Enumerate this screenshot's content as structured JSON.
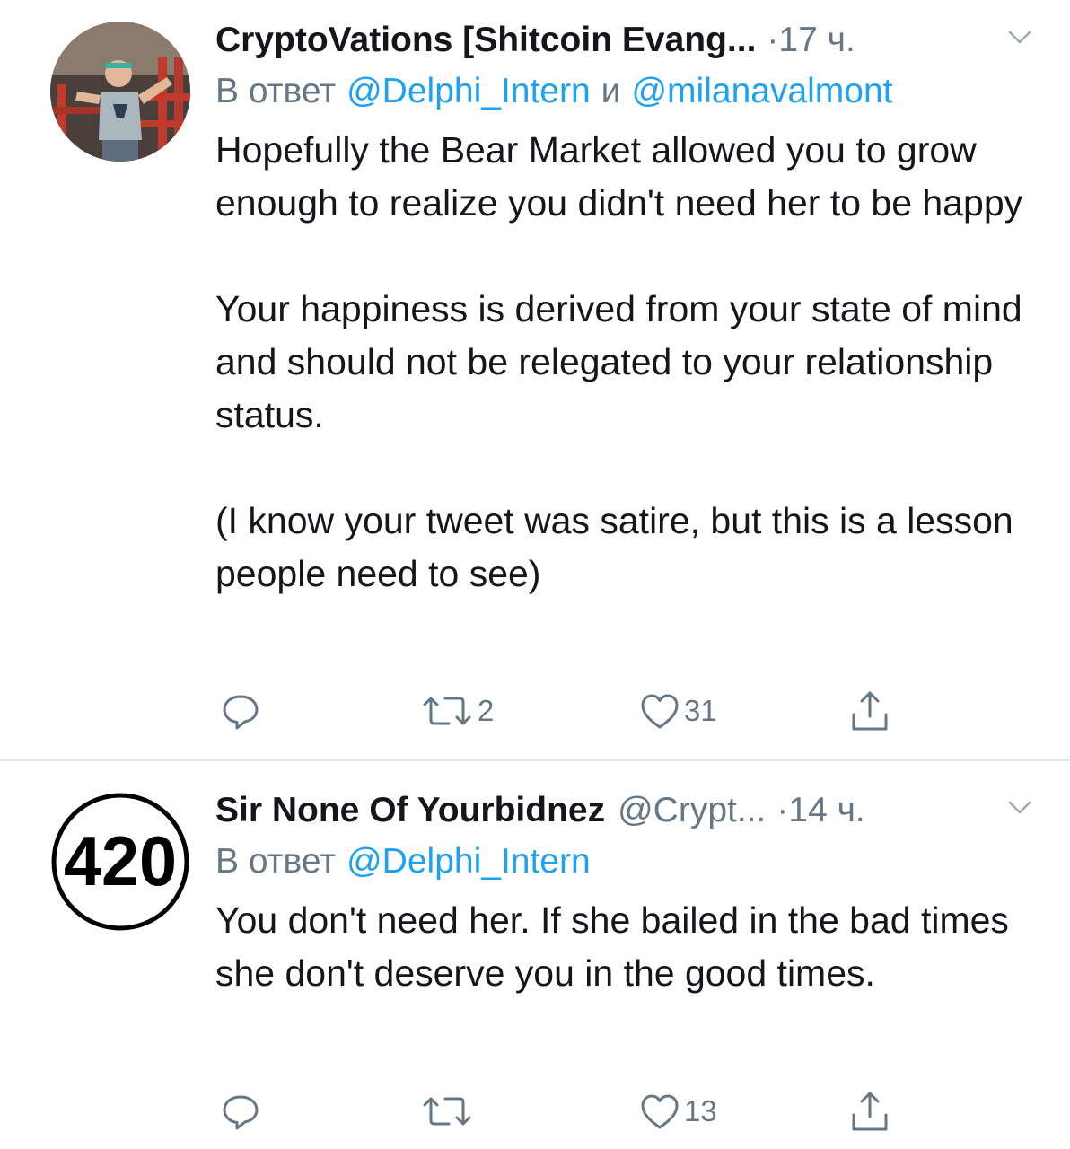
{
  "tweets": [
    {
      "display_name": "CryptoVations [Shitcoin Evang...",
      "handle": "",
      "separator": "·",
      "time": "17 ч.",
      "reply_prefix": "В ответ",
      "reply_mention_1": "@Delphi_Intern",
      "reply_conjunction": "и",
      "reply_mention_2": "@milanavalmont",
      "paragraphs": [
        "Hopefully the Bear Market allowed you to grow enough to realize you didn't need her to be happy",
        "Your happiness is derived from your state of mind and should not be relegated to your relationship status.",
        "(I know your tweet was satire, but this is a lesson people need to see)"
      ],
      "reply_count": "",
      "retweet_count": "2",
      "like_count": "31",
      "avatar_icon": "person-photo-avatar"
    },
    {
      "display_name": "Sir None Of Yourbidnez",
      "handle": "@Crypt...",
      "separator": "·",
      "time": "14 ч.",
      "reply_prefix": "В ответ",
      "reply_mention_1": "@Delphi_Intern",
      "paragraphs": [
        "You don't need her. If she bailed in the bad times she don't deserve you in the good times."
      ],
      "reply_count": "",
      "retweet_count": "",
      "like_count": "13",
      "avatar_text": "420"
    }
  ],
  "colors": {
    "text": "#14171a",
    "secondary": "#657786",
    "link": "#1da1f2",
    "divider": "#e1e8ed"
  },
  "icons": [
    "reply-icon",
    "retweet-icon",
    "like-icon",
    "share-icon",
    "chevron-down-icon"
  ]
}
